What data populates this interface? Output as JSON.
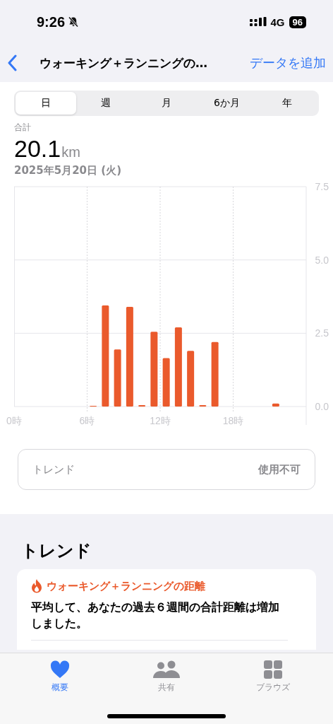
{
  "status_bar": {
    "time": "9:26",
    "network": "4G",
    "battery": "96"
  },
  "nav": {
    "title": "ウォーキング＋ランニングの…",
    "action": "データを追加"
  },
  "tabs": [
    {
      "label": "日",
      "selected": true
    },
    {
      "label": "週",
      "selected": false
    },
    {
      "label": "月",
      "selected": false
    },
    {
      "label": "6か月",
      "selected": false
    },
    {
      "label": "年",
      "selected": false
    }
  ],
  "summary": {
    "label": "合計",
    "value": "20.1",
    "unit": "km",
    "date": "2025年5月20日 (火)"
  },
  "chart_data": {
    "type": "bar",
    "grid": true,
    "x": [
      6.5,
      7.5,
      8.5,
      9.5,
      10.5,
      11.5,
      12.5,
      13.5,
      14.5,
      15.5,
      16.5,
      21.5
    ],
    "xlim": [
      0,
      24
    ],
    "series": [
      {
        "color": "#ea5a2c",
        "values": [
          0.02,
          3.45,
          1.95,
          3.4,
          0.05,
          2.55,
          1.65,
          2.7,
          1.9,
          0.05,
          2.2,
          0.1
        ]
      }
    ],
    "ylim": [
      0,
      7.5
    ],
    "yticks": [
      {
        "value": 0,
        "label": "0.0"
      },
      {
        "value": 2.5,
        "label": "2.5"
      },
      {
        "value": 5,
        "label": "5.0"
      },
      {
        "value": 7.5,
        "label": "7.5"
      }
    ],
    "xticks": [
      {
        "value": 0,
        "label": "0時"
      },
      {
        "value": 6,
        "label": "6時"
      },
      {
        "value": 12,
        "label": "12時"
      },
      {
        "value": 18,
        "label": "18時"
      }
    ]
  },
  "trend_row": {
    "label": "トレンド",
    "value": "使用不可"
  },
  "trends": {
    "heading": "トレンド",
    "card": {
      "title": "ウォーキング＋ランニングの距離",
      "text": "平均して、あなたの過去６週間の合計距離は増加しました。"
    }
  },
  "tab_bar": [
    {
      "label": "概要",
      "selected": true
    },
    {
      "label": "共有",
      "selected": false
    },
    {
      "label": "ブラウズ",
      "selected": false
    }
  ]
}
